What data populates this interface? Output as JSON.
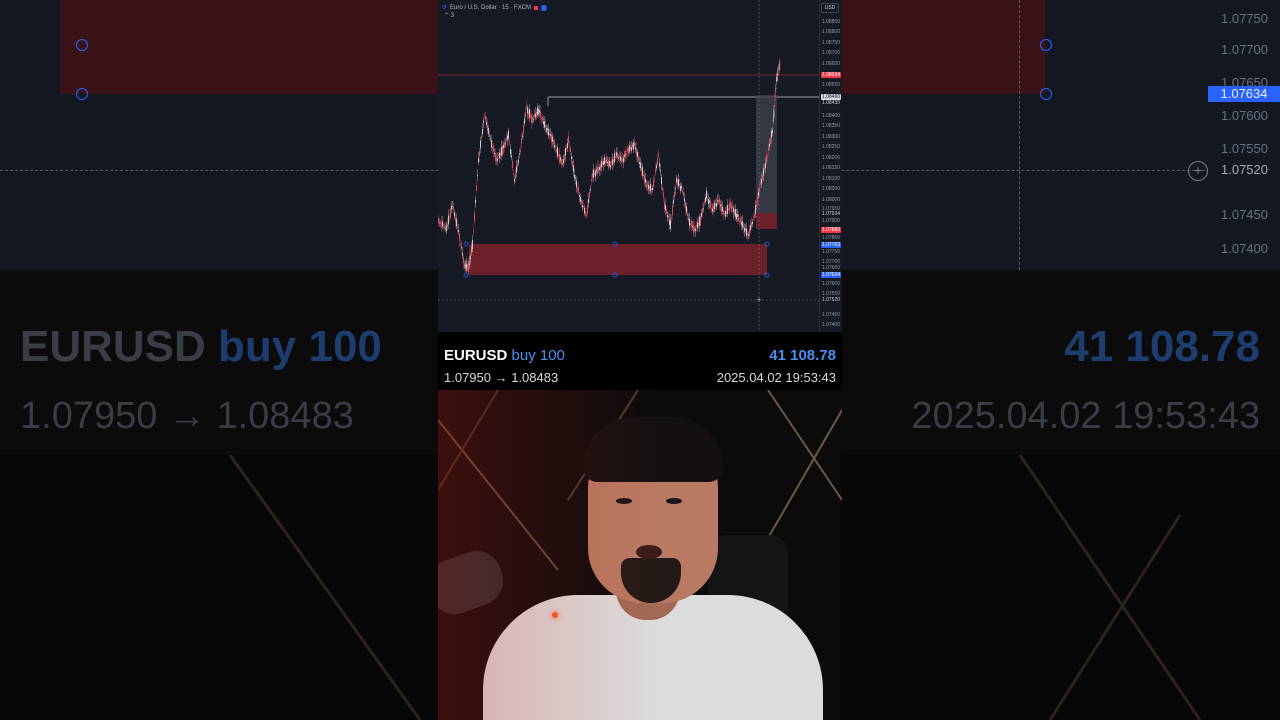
{
  "chart": {
    "symbol_title": "Euro / U.S. Dollar · 15 · FXCM",
    "indicator_count": "3",
    "currency_button": "USD",
    "axis_ticks": [
      "1.08850",
      "1.08800",
      "1.08750",
      "1.08700",
      "1.08650",
      "1.08550",
      "1.08450",
      "1.08400",
      "1.08350",
      "1.08300",
      "1.08250",
      "1.08200",
      "1.08150",
      "1.08100",
      "1.08050",
      "1.08000",
      "1.07950",
      "1.07900",
      "1.07850",
      "1.07750",
      "1.07700",
      "1.07650",
      "1.07600",
      "1.07550",
      "1.07450",
      "1.07400"
    ],
    "price_tags": {
      "current": "1.08634",
      "line_upper": "1.08490",
      "line_lower": "1.08430",
      "entry": "1.07934",
      "stop": "1.07880",
      "zone_top": "1.07763",
      "zone_bottom": "1.07634",
      "crosshair": "1.07520"
    }
  },
  "trade": {
    "pair": "EURUSD",
    "direction": "buy 100",
    "profit": "41 108.78",
    "price_move": "1.07950 → 1.08483",
    "timestamp": "2025.04.02 19:53:43"
  },
  "background": {
    "axis_ticks": [
      "1.07750",
      "1.07700",
      "1.07650",
      "1.07600",
      "1.07550",
      "1.07450",
      "1.07400"
    ],
    "blue_tag": "1.07634",
    "crosshair_tag": "1.07520"
  },
  "colors": {
    "chart_bg": "#161a25",
    "bull": "#c8c9ce",
    "bear": "#e04a55",
    "zone": "#6b1f28",
    "accent": "#4a90f0"
  }
}
